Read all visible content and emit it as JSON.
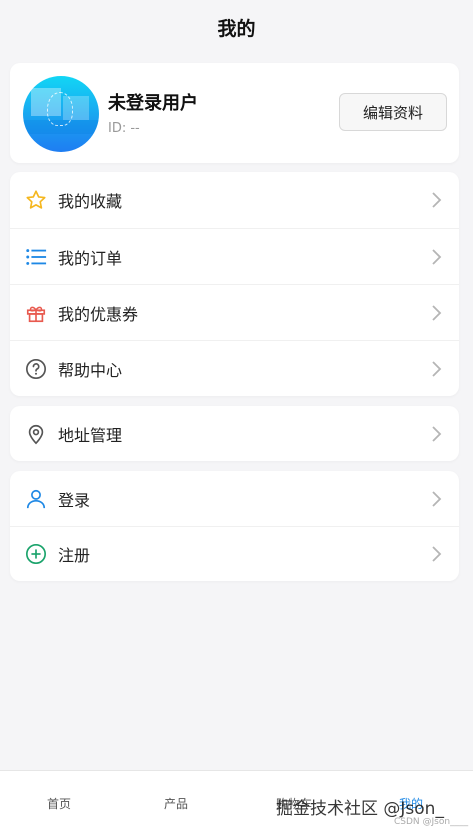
{
  "navbar": {
    "title": "我的"
  },
  "profile": {
    "username": "未登录用户",
    "user_id": "ID: --",
    "edit_label": "编辑资料"
  },
  "menu_group_1": [
    {
      "label": "我的收藏",
      "icon": "star-icon"
    },
    {
      "label": "我的订单",
      "icon": "list-icon"
    },
    {
      "label": "我的优惠券",
      "icon": "gift-icon"
    },
    {
      "label": "帮助中心",
      "icon": "help-icon"
    }
  ],
  "menu_group_2": [
    {
      "label": "地址管理",
      "icon": "location-icon"
    }
  ],
  "menu_group_3": [
    {
      "label": "登录",
      "icon": "user-icon"
    },
    {
      "label": "注册",
      "icon": "add-circle-icon"
    }
  ],
  "tabbar": {
    "tabs": [
      {
        "label": "首页"
      },
      {
        "label": "产品"
      },
      {
        "label": "购物车"
      },
      {
        "label": "我的"
      }
    ],
    "active_color": "#1e88e5"
  },
  "watermark": {
    "text": "掘金技术社区 @Json_",
    "sub": "CSDN @Json____"
  },
  "colors": {
    "star": "#f5b71f",
    "list": "#1e88e5",
    "gift": "#e85a4f",
    "help": "#555555",
    "location": "#555555",
    "user": "#1e88e5",
    "add": "#1aa36b"
  }
}
